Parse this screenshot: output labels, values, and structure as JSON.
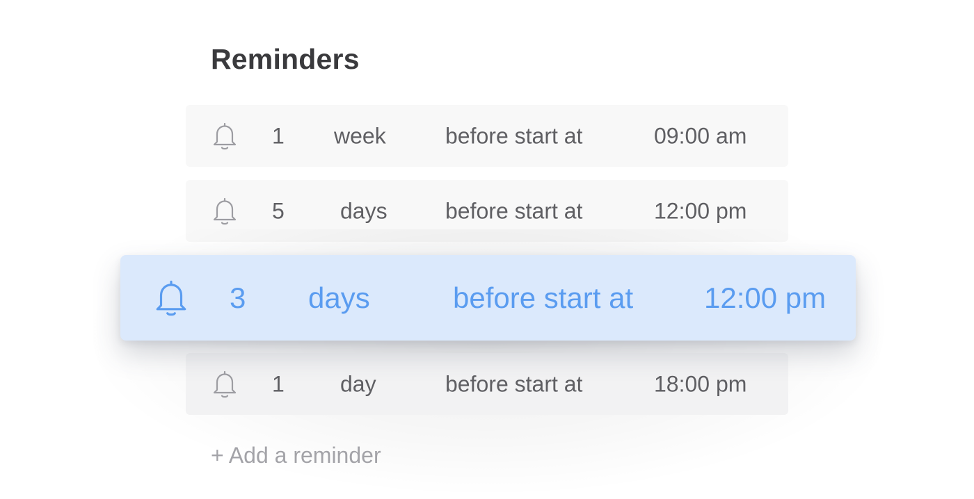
{
  "title": "Reminders",
  "colors": {
    "active_background": "#dbe9fc",
    "active_text": "#5a9cf0",
    "row_background": "#f8f8f8",
    "row_text": "#5f5f63",
    "muted_text": "#a3a3a8"
  },
  "reminders": [
    {
      "icon": "bell-icon",
      "amount": "1",
      "unit": "week",
      "relation": "before start at",
      "time": "09:00 am",
      "active": false
    },
    {
      "icon": "bell-icon",
      "amount": "5",
      "unit": "days",
      "relation": "before start at",
      "time": "12:00 pm",
      "active": false
    },
    {
      "icon": "bell-icon",
      "amount": "3",
      "unit": "days",
      "relation": "before start at",
      "time": "12:00 pm",
      "active": true
    },
    {
      "icon": "bell-icon",
      "amount": "1",
      "unit": "day",
      "relation": "before start at",
      "time": "18:00 pm",
      "active": false
    }
  ],
  "add_label": "+ Add a reminder"
}
